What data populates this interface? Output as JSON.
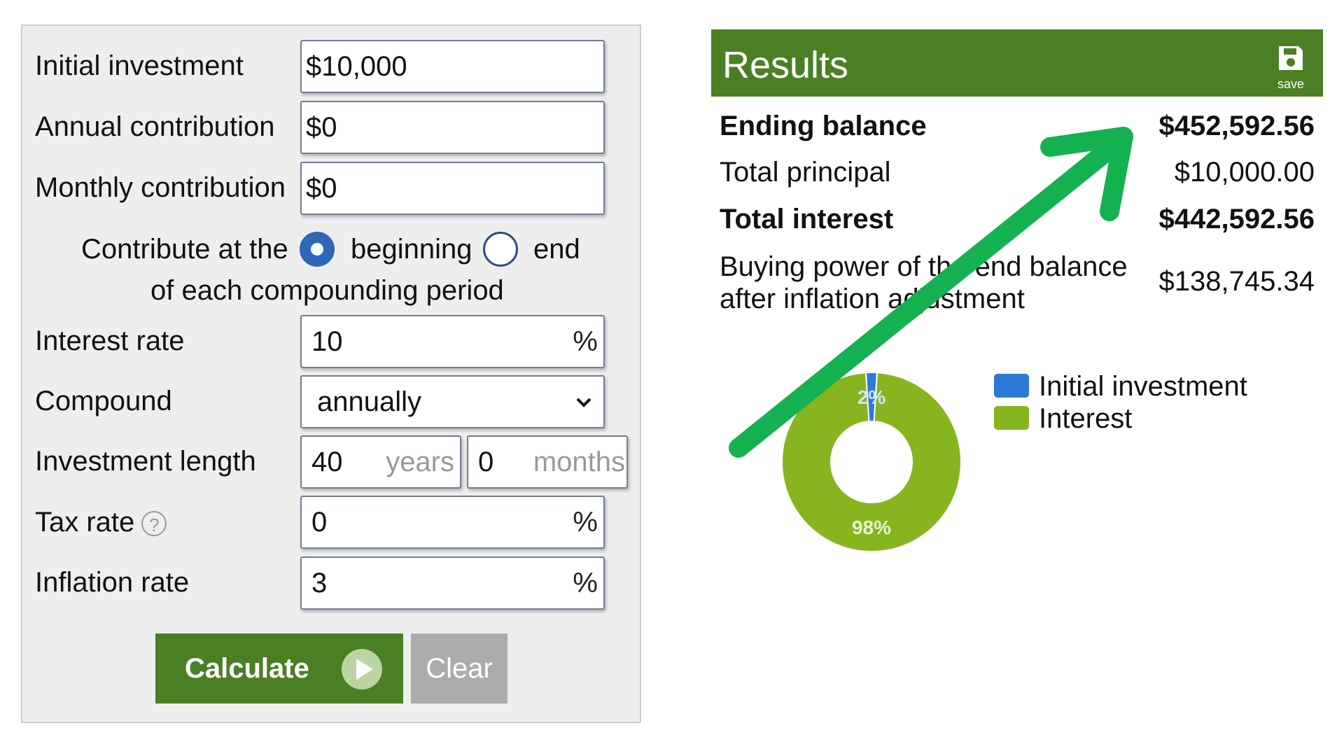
{
  "form": {
    "initial_investment": {
      "label": "Initial investment",
      "value": "$10,000"
    },
    "annual_contribution": {
      "label": "Annual contribution",
      "value": "$0"
    },
    "monthly_contribution": {
      "label": "Monthly contribution",
      "value": "$0"
    },
    "contribute_timing": {
      "prefix": "Contribute at the",
      "option_beginning": "beginning",
      "option_end": "end",
      "suffix": "of each compounding period",
      "selected": "beginning"
    },
    "interest_rate": {
      "label": "Interest rate",
      "value": "10",
      "unit": "%"
    },
    "compound": {
      "label": "Compound",
      "value": "annually"
    },
    "investment_length": {
      "label": "Investment length",
      "years": "40",
      "years_unit": "years",
      "months": "0",
      "months_unit": "months"
    },
    "tax_rate": {
      "label": "Tax rate",
      "value": "0",
      "unit": "%",
      "help": "?"
    },
    "inflation_rate": {
      "label": "Inflation rate",
      "value": "3",
      "unit": "%"
    },
    "calculate_label": "Calculate",
    "clear_label": "Clear"
  },
  "results": {
    "title": "Results",
    "save_label": "save",
    "ending_balance": {
      "label": "Ending balance",
      "value": "$452,592.56"
    },
    "total_principal": {
      "label": "Total principal",
      "value": "$10,000.00"
    },
    "total_interest": {
      "label": "Total interest",
      "value": "$442,592.56"
    },
    "buying_power": {
      "label_line1": "Buying power of the end balance",
      "label_line2": "after inflation adjustment",
      "value": "$138,745.34"
    }
  },
  "chart_data": {
    "type": "pie",
    "categories": [
      "Initial investment",
      "Interest"
    ],
    "values": [
      2,
      98
    ],
    "labels": [
      "2%",
      "98%"
    ],
    "colors": [
      "#2c7ad6",
      "#86b520"
    ],
    "legend": "right"
  },
  "colors": {
    "brand_green": "#4b7f23",
    "arrow_green": "#14b150",
    "radio_blue": "#2c68b6"
  }
}
